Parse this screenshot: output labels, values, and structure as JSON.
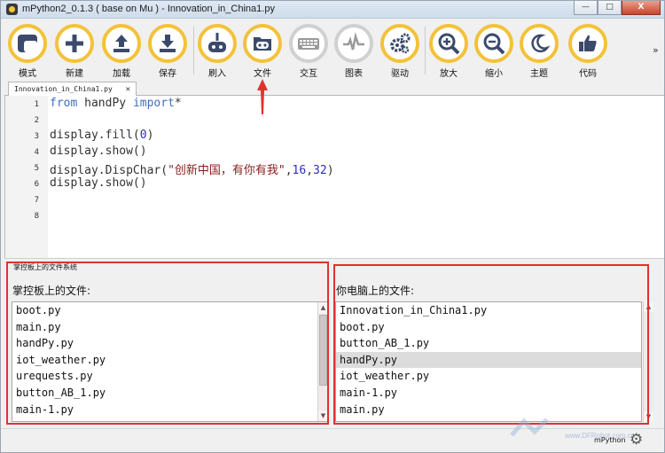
{
  "window": {
    "title": "mPython2_0.1.3 ( base on Mu ) - Innovation_in_China1.py",
    "controls": {
      "minimize": "—",
      "maximize": "□",
      "close": "X"
    }
  },
  "toolbar": {
    "accent_color": "#f3c23a",
    "tools": [
      {
        "id": "mode",
        "label": "模式",
        "icon": "mode-icon"
      },
      {
        "id": "new",
        "label": "新建",
        "icon": "plus-icon"
      },
      {
        "id": "load",
        "label": "加载",
        "icon": "upload-icon"
      },
      {
        "id": "save",
        "label": "保存",
        "icon": "download-icon"
      },
      {
        "id": "flash",
        "label": "刷入",
        "icon": "board-flash-icon"
      },
      {
        "id": "files",
        "label": "文件",
        "icon": "board-files-icon"
      },
      {
        "id": "repl",
        "label": "交互",
        "icon": "keyboard-icon"
      },
      {
        "id": "plotter",
        "label": "图表",
        "icon": "pulse-icon"
      },
      {
        "id": "drivers",
        "label": "驱动",
        "icon": "gears-icon"
      },
      {
        "id": "zoom_in",
        "label": "放大",
        "icon": "zoom-in-icon"
      },
      {
        "id": "zoom_out",
        "label": "缩小",
        "icon": "zoom-out-icon"
      },
      {
        "id": "theme",
        "label": "主题",
        "icon": "moon-icon"
      },
      {
        "id": "check",
        "label": "代码",
        "icon": "thumbs-up-icon"
      }
    ],
    "more": "»"
  },
  "tabs": [
    {
      "label": "Innovation_in_China1.py",
      "close": "✕"
    }
  ],
  "editor": {
    "line_numbers": [
      "1",
      "2",
      "3",
      "4",
      "5",
      "6",
      "7",
      "8"
    ],
    "lines": {
      "l1_from": "from",
      "l1_mod": " handPy ",
      "l1_import": "import",
      "l1_star": "*",
      "l3_a": "display.fill(",
      "l3_num": "0",
      "l3_b": ")",
      "l4": "display.show()",
      "l5_a": "display.DispChar(",
      "l5_str": "\"创新中国，有你有我\"",
      "l5_comma1": ",",
      "l5_n1": "16",
      "l5_comma2": ",",
      "l5_n2": "32",
      "l5_b": ")",
      "l6": "display.show()"
    }
  },
  "file_panel": {
    "title": "掌控板上的文件系统",
    "device": {
      "label": "掌控板上的文件:",
      "files": [
        "boot.py",
        "main.py",
        "handPy.py",
        "iot_weather.py",
        "urequests.py",
        "button_AB_1.py",
        "main-1.py"
      ]
    },
    "computer": {
      "label": "你电脑上的文件:",
      "files": [
        "Innovation_in_China1.py",
        "boot.py",
        "button_AB_1.py",
        "handPy.py",
        "iot_weather.py",
        "main-1.py",
        "main.py"
      ],
      "selected": "handPy.py"
    },
    "highlight_color": "#e23131"
  },
  "statusbar": {
    "mode": "mPython",
    "watermark": "www.DFRobot.com.cn"
  }
}
